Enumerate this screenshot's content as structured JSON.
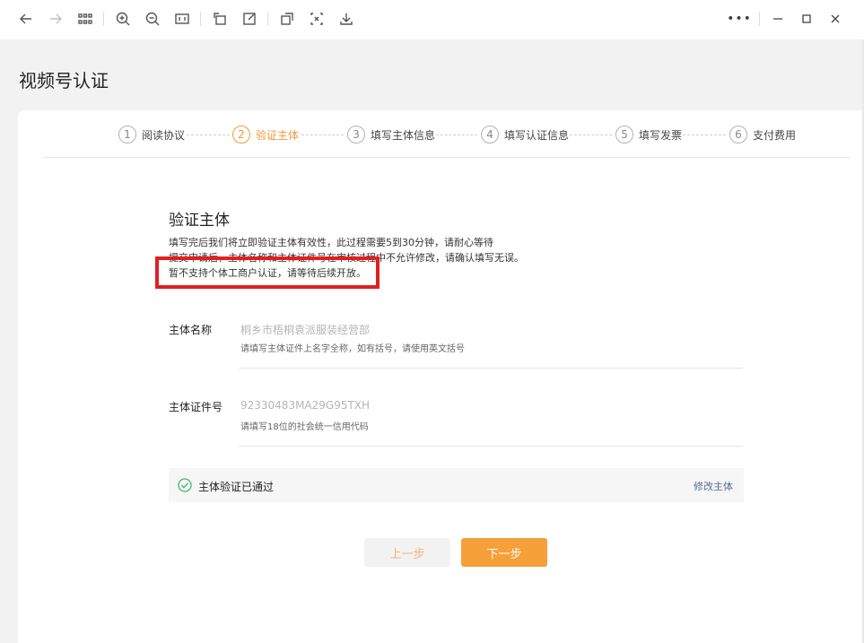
{
  "toolbar": {
    "icons": [
      "back-arrow-icon",
      "forward-arrow-icon",
      "grid-icon",
      "zoom-in-icon",
      "zoom-out-icon",
      "fit-page-icon",
      "rotate-icon",
      "edit-icon",
      "export-icon",
      "select-icon",
      "download-icon"
    ],
    "more": "•••"
  },
  "page": {
    "title": "视频号认证"
  },
  "steps": [
    {
      "num": "1",
      "label": "阅读协议"
    },
    {
      "num": "2",
      "label": "验证主体"
    },
    {
      "num": "3",
      "label": "填写主体信息"
    },
    {
      "num": "4",
      "label": "填写认证信息"
    },
    {
      "num": "5",
      "label": "填写发票"
    },
    {
      "num": "6",
      "label": "支付费用"
    }
  ],
  "active_step": 2,
  "section": {
    "title": "验证主体",
    "desc1": "填写完后我们将立即验证主体有效性，此过程需要5到30分钟，请耐心等待",
    "desc2": "提交申请后，主体名称和主体证件号在审核过程中不允许修改，请确认填写无误。",
    "desc3": "暂不支持个体工商户认证，请等待后续开放。"
  },
  "fields": {
    "name_label": "主体名称",
    "name_value": "桐乡市梧桐袁派服装经营部",
    "name_hint": "请填写主体证件上名字全称，如有括号，请使用英文括号",
    "id_label": "主体证件号",
    "id_value": "92330483MA29G95TXH",
    "id_hint": "请填写18位的社会统一信用代码"
  },
  "verify": {
    "status": "主体验证已通过",
    "modify": "修改主体",
    "color": "#3fba6c"
  },
  "buttons": {
    "prev": "上一步",
    "next": "下一步"
  },
  "colors": {
    "accent": "#f6a03a",
    "highlight": "#e0201f"
  }
}
